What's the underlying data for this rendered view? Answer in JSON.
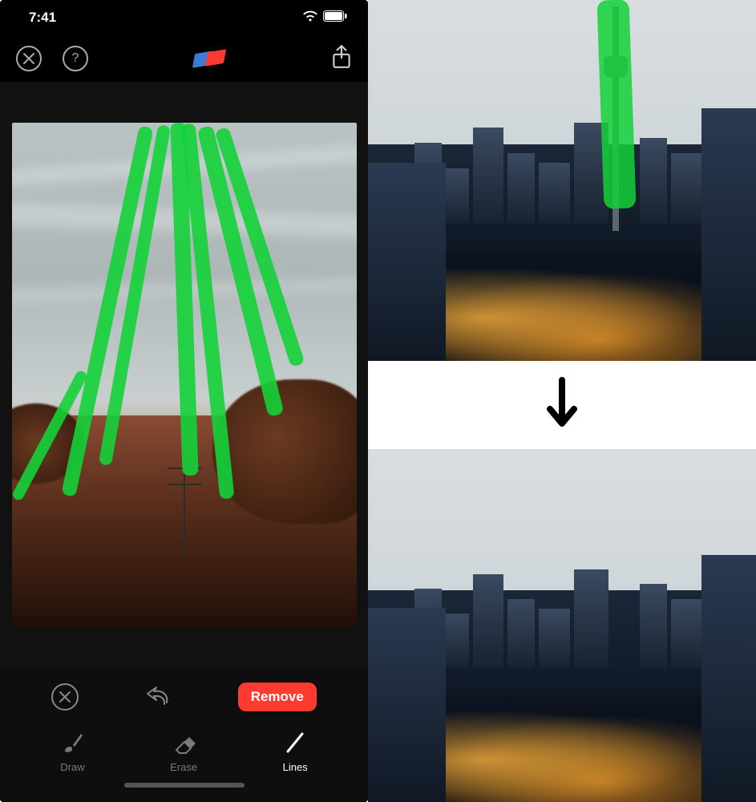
{
  "status": {
    "time": "7:41",
    "wifi": "wifi-icon",
    "battery": "battery-icon"
  },
  "topbar": {
    "close": "close-icon",
    "help_glyph": "?",
    "tool": "eraser-tool-icon",
    "share": "share-icon"
  },
  "canvas": {
    "marker_color": "#14d138"
  },
  "actions": {
    "cancel": "close-icon",
    "undo": "undo-icon",
    "remove_label": "Remove"
  },
  "tools": [
    {
      "id": "draw",
      "label": "Draw",
      "icon": "brush-icon",
      "active": false
    },
    {
      "id": "erase",
      "label": "Erase",
      "icon": "eraser-icon",
      "active": false
    },
    {
      "id": "lines",
      "label": "Lines",
      "icon": "line-icon",
      "active": true
    }
  ],
  "comparison": {
    "direction_icon": "arrow-down-icon"
  }
}
